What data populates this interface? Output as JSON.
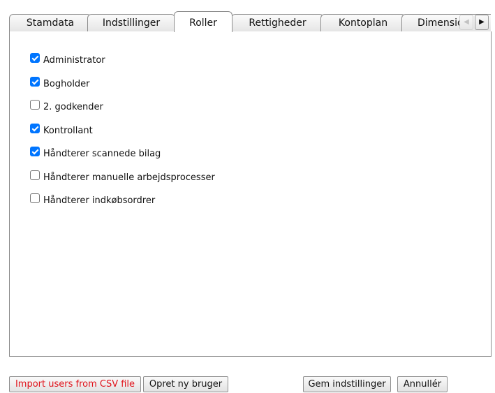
{
  "tabs": [
    {
      "label": "Stamdata"
    },
    {
      "label": "Indstillinger"
    },
    {
      "label": "Roller",
      "active": true
    },
    {
      "label": "Rettigheder"
    },
    {
      "label": "Kontoplan"
    },
    {
      "label": "Dimensio"
    }
  ],
  "tab_scroll": {
    "left_icon": "chevron-left-icon",
    "right_icon": "chevron-right-icon",
    "left": "◀",
    "right": "▶"
  },
  "roles": [
    {
      "label": "Administrator",
      "checked": true
    },
    {
      "label": "Bogholder",
      "checked": true
    },
    {
      "label": "2. godkender",
      "checked": false
    },
    {
      "label": "Kontrollant",
      "checked": true
    },
    {
      "label": "Håndterer scannede bilag",
      "checked": true
    },
    {
      "label": "Håndterer manuelle arbejdsprocesser",
      "checked": false
    },
    {
      "label": "Håndterer indkøbsordrer",
      "checked": false
    }
  ],
  "buttons": {
    "import_csv": "Import users from CSV file",
    "new_user": "Opret ny bruger",
    "save": "Gem indstillinger",
    "cancel": "Annullér"
  },
  "colors": {
    "checkbox_checked": "#0075ff",
    "import_button_text": "#e0121a"
  }
}
